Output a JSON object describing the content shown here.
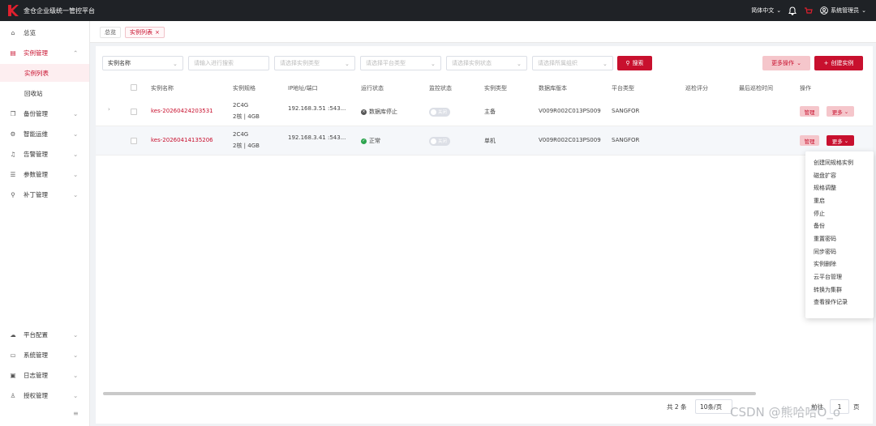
{
  "app": {
    "title": "金仓企业级统一管控平台",
    "brand_color": "#c8102e",
    "language": "简体中文",
    "user": "系统管理员"
  },
  "sidebar": {
    "top_items": [
      {
        "label": "总览",
        "icon": "home-icon"
      },
      {
        "label": "实例管理",
        "icon": "database-icon",
        "expanded": true,
        "children": [
          {
            "label": "实例列表",
            "active": true
          },
          {
            "label": "回收站"
          }
        ]
      },
      {
        "label": "备份管理",
        "icon": "backup-icon"
      },
      {
        "label": "智能运维",
        "icon": "ops-icon"
      },
      {
        "label": "告警管理",
        "icon": "bell-icon"
      },
      {
        "label": "参数管理",
        "icon": "list-icon"
      },
      {
        "label": "补丁管理",
        "icon": "wrench-icon"
      }
    ],
    "bottom_items": [
      {
        "label": "平台配置",
        "icon": "cloud-icon"
      },
      {
        "label": "系统管理",
        "icon": "monitor-icon"
      },
      {
        "label": "日志管理",
        "icon": "log-icon"
      },
      {
        "label": "授权管理",
        "icon": "user-icon"
      }
    ],
    "collapse_icon": "hamburger-icon"
  },
  "tabs": [
    {
      "label": "总览"
    },
    {
      "label": "实例列表",
      "close": "×",
      "active": true
    }
  ],
  "filters": {
    "field_select": "实例名称",
    "search_placeholder": "请输入进行搜索",
    "type_placeholder": "请选择实例类型",
    "platform_placeholder": "请选择平台类型",
    "status_placeholder": "请选择实例状态",
    "org_placeholder": "请选择所属组织",
    "search_button": "搜索",
    "more_actions": "更多操作",
    "create_button": "创建实例"
  },
  "table": {
    "columns": [
      "实例名称",
      "实例规格",
      "IP地址/端口",
      "运行状态",
      "监控状态",
      "实例类型",
      "数据库版本",
      "平台类型",
      "巡检评分",
      "最后巡检时间",
      "操作"
    ],
    "rows": [
      {
        "name": "kes-20260424203531",
        "spec1": "2C4G",
        "spec2": "2核 | 4GB",
        "ip": "192.168.3.51 :543...",
        "status": "数据库停止",
        "monitor": "关闭",
        "type": "主备",
        "version": "V009R002C013PS009",
        "platform": "SANGFOR",
        "manage": "管理",
        "more": "更多"
      },
      {
        "name": "kes-20260414135206",
        "spec1": "2C4G",
        "spec2": "2核 | 4GB",
        "ip": "192.168.3.41 :543...",
        "status": "正常",
        "monitor": "关闭",
        "type": "单机",
        "version": "V009R002C013PS009",
        "platform": "SANGFOR",
        "manage": "管理",
        "more": "更多"
      }
    ]
  },
  "dropdown_menu": [
    "创建同规格实例",
    "磁盘扩容",
    "规格调整",
    "重启",
    "停止",
    "备份",
    "重置密码",
    "同步密码",
    "实例删除",
    "云平台管理",
    "转换为集群",
    "查看操作记录"
  ],
  "pagination": {
    "total": "共 2 条",
    "page_size": "10条/页",
    "goto_label": "前往",
    "page": "1",
    "page_unit": "页"
  },
  "watermark": "CSDN @熊哈哈O_o"
}
